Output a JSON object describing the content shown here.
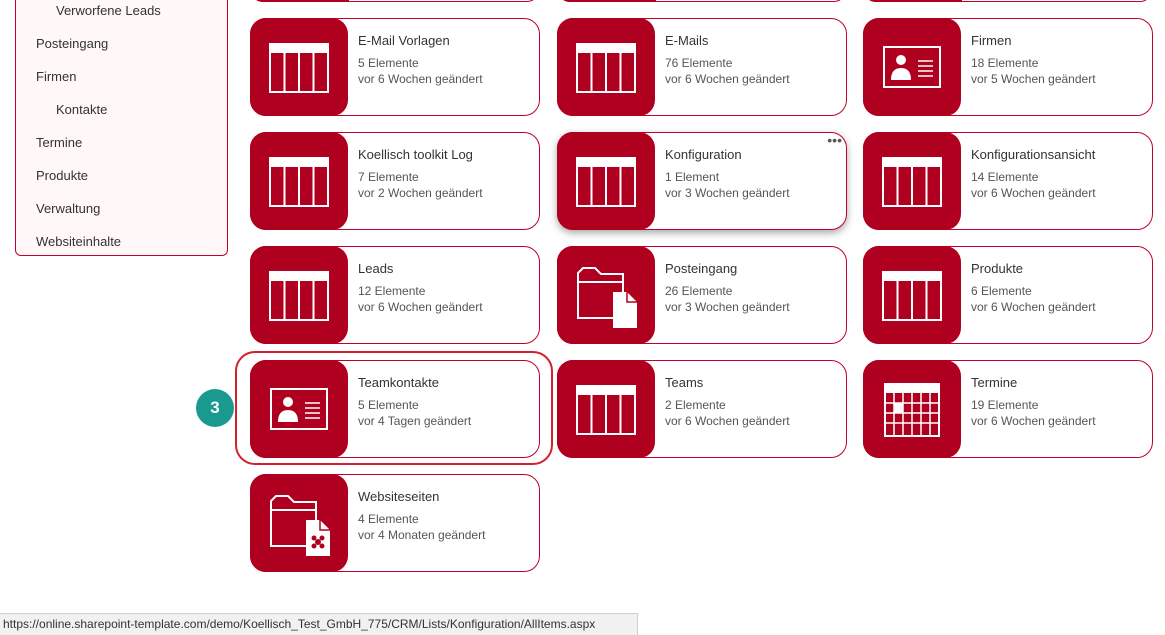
{
  "colors": {
    "accent": "#b00020",
    "border": "#c1002b",
    "badge": "#1a9a8e"
  },
  "sidebar": {
    "items": [
      {
        "label": "Verworfene Leads",
        "sub": true
      },
      {
        "label": "Posteingang",
        "sub": false
      },
      {
        "label": "Firmen",
        "sub": false
      },
      {
        "label": "Kontakte",
        "sub": true
      },
      {
        "label": "Termine",
        "sub": false
      },
      {
        "label": "Produkte",
        "sub": false
      },
      {
        "label": "Verwaltung",
        "sub": false
      },
      {
        "label": "Websiteinhalte",
        "sub": false
      }
    ]
  },
  "tiles": [
    {
      "title": "E-Mail Vorlagen",
      "count": "5 Elemente",
      "modified": "vor 6 Wochen geändert",
      "icon": "list-icon"
    },
    {
      "title": "E-Mails",
      "count": "76 Elemente",
      "modified": "vor 6 Wochen geändert",
      "icon": "list-icon"
    },
    {
      "title": "Firmen",
      "count": "18 Elemente",
      "modified": "vor 5 Wochen geändert",
      "icon": "contact-card-icon"
    },
    {
      "title": "Koellisch toolkit Log",
      "count": "7 Elemente",
      "modified": "vor 2 Wochen geändert",
      "icon": "list-icon"
    },
    {
      "title": "Konfiguration",
      "count": "1 Element",
      "modified": "vor 3 Wochen geändert",
      "icon": "list-icon",
      "more": "•••"
    },
    {
      "title": "Konfigurationsansicht",
      "count": "14 Elemente",
      "modified": "vor 6 Wochen geändert",
      "icon": "list-icon"
    },
    {
      "title": "Leads",
      "count": "12 Elemente",
      "modified": "vor 6 Wochen geändert",
      "icon": "list-icon"
    },
    {
      "title": "Posteingang",
      "count": "26 Elemente",
      "modified": "vor 3 Wochen geändert",
      "icon": "folder-doc-icon"
    },
    {
      "title": "Produkte",
      "count": "6 Elemente",
      "modified": "vor 6 Wochen geändert",
      "icon": "list-icon"
    },
    {
      "title": "Teamkontakte",
      "count": "5 Elemente",
      "modified": "vor 4 Tagen geändert",
      "icon": "contact-card-icon"
    },
    {
      "title": "Teams",
      "count": "2 Elemente",
      "modified": "vor 6 Wochen geändert",
      "icon": "list-icon"
    },
    {
      "title": "Termine",
      "count": "19 Elemente",
      "modified": "vor 6 Wochen geändert",
      "icon": "calendar-icon"
    },
    {
      "title": "Websiteseiten",
      "count": "4 Elemente",
      "modified": "vor 4 Monaten geändert",
      "icon": "folder-page-icon"
    }
  ],
  "step_badge": "3",
  "status_url": "https://online.sharepoint-template.com/demo/Koellisch_Test_GmbH_775/CRM/Lists/Konfiguration/AllItems.aspx"
}
